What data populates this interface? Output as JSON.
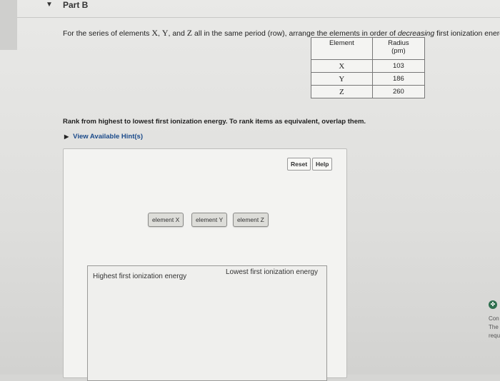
{
  "part": {
    "toggle_icon": "caret-down-icon",
    "toggle_glyph": "▼",
    "title": "Part B"
  },
  "question": {
    "lead": "For the series of elements ",
    "sym_x": "X",
    "sep1": ", ",
    "sym_y": "Y",
    "sep2": ", and ",
    "sym_z": "Z",
    "middle": " all in the same period (row), arrange the elements in order of ",
    "emphasis": "decreasing",
    "tail": " first ionization energy."
  },
  "table": {
    "headers": [
      "Element",
      "Radius",
      "(pm)"
    ],
    "rows": [
      {
        "element": "X",
        "radius": "103"
      },
      {
        "element": "Y",
        "radius": "186"
      },
      {
        "element": "Z",
        "radius": "260"
      }
    ]
  },
  "instruction": "Rank from highest to lowest first ionization energy. To rank items as equivalent, overlap them.",
  "hint": {
    "icon": "triangle-right-icon",
    "glyph": "▶",
    "label": "View Available Hint(s)"
  },
  "buttons": {
    "reset": "Reset",
    "help": "Help"
  },
  "items": [
    "element X",
    "element Y",
    "element Z"
  ],
  "ranking": {
    "high_label": "Highest first ionization energy",
    "low_label": "Lowest first ionization energy"
  },
  "side": {
    "icon": "globe-icon",
    "glyph": "✤",
    "lines": [
      "Con",
      "The",
      "requ"
    ]
  }
}
